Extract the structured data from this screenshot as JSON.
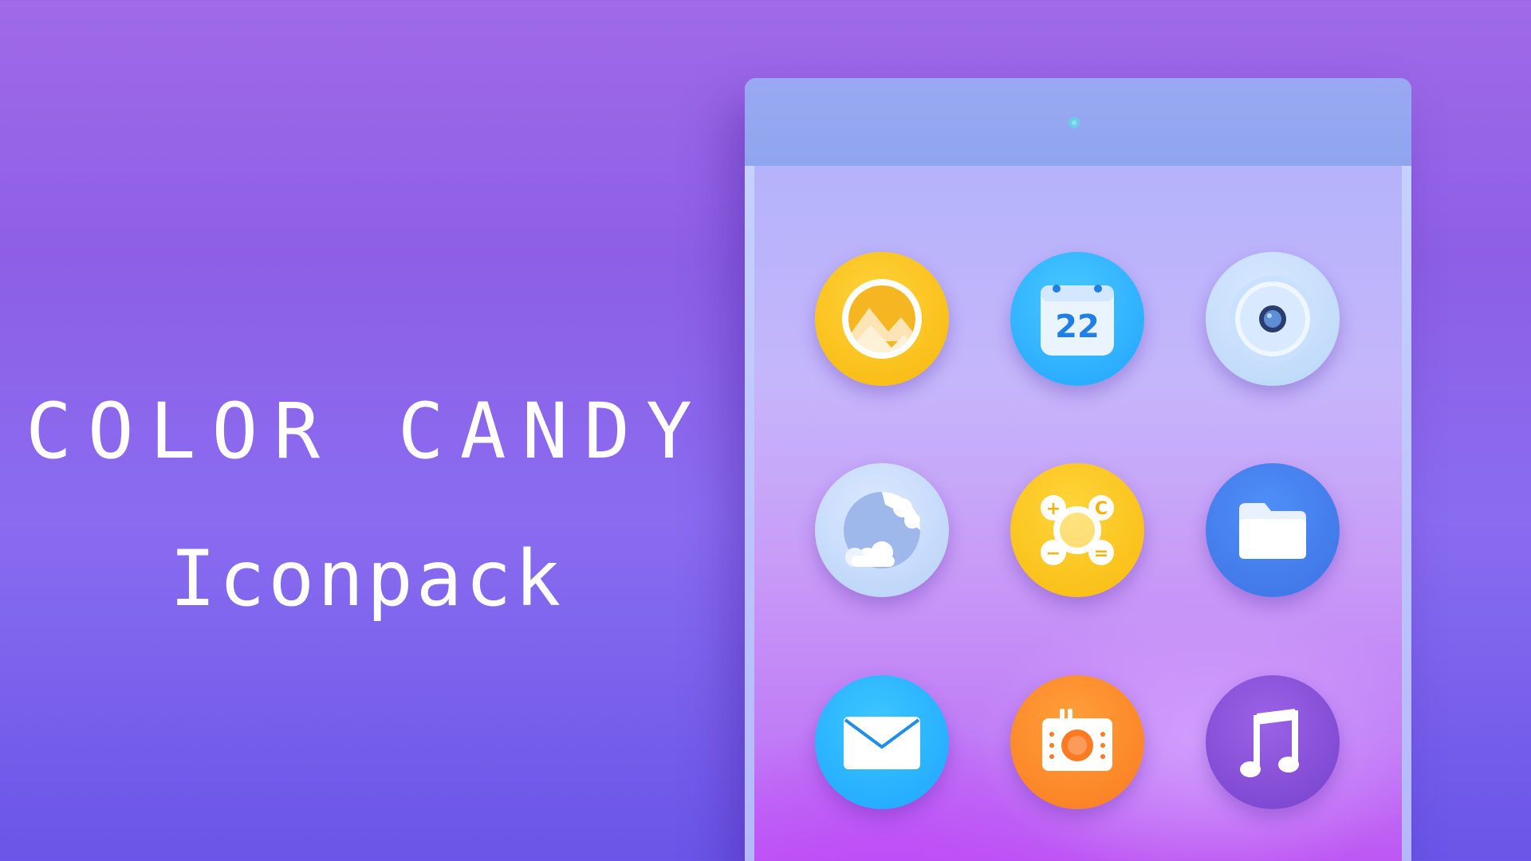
{
  "headline": {
    "title": "COLOR CANDY",
    "subtitle": "Iconpack"
  },
  "colors": {
    "background_top": "#a06ae8",
    "background_bottom": "#6a55e8",
    "text": "#ffffff",
    "tablet_bezel": "#8fa5ee"
  },
  "tablet": {
    "icons": [
      {
        "name": "gallery-icon",
        "color": "#f8b80c"
      },
      {
        "name": "calendar-icon",
        "color": "#22a4ff",
        "day": "22"
      },
      {
        "name": "camera-icon",
        "color": "#b7d6f8"
      },
      {
        "name": "weather-icon",
        "color": "#b6d1f8"
      },
      {
        "name": "calculator-icon",
        "color": "#f8ba0e",
        "symbols": [
          "+",
          "C",
          "−",
          "="
        ]
      },
      {
        "name": "files-icon",
        "color": "#3d72e4"
      },
      {
        "name": "mail-icon",
        "color": "#1ea5ff"
      },
      {
        "name": "radio-icon",
        "color": "#fb7a22"
      },
      {
        "name": "music-icon",
        "color": "#7642cb"
      }
    ]
  }
}
